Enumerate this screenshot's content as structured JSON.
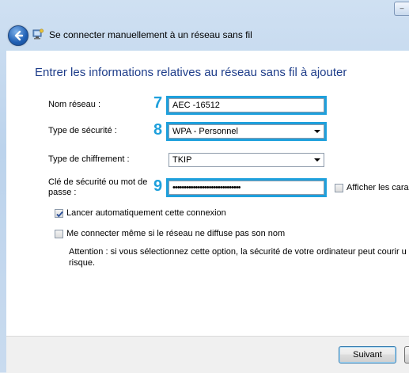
{
  "window": {
    "title": "Se connecter manuellement à un réseau sans fil",
    "minimize_glyph": "–"
  },
  "heading": "Entrer les informations relatives au réseau sans fil à ajouter",
  "form": {
    "network_name": {
      "label": "Nom réseau :",
      "value": "AEC -16512",
      "step": "7"
    },
    "security_type": {
      "label": "Type de sécurité :",
      "value": "WPA - Personnel",
      "step": "8"
    },
    "encryption_type": {
      "label": "Type de chiffrement :",
      "value": "TKIP"
    },
    "security_key": {
      "label_line1": "Clé de sécurité ou mot de",
      "label_line2": "passe :",
      "value": "••••••••••••••••••••••••••••••",
      "step": "9",
      "show_chars_label": "Afficher les cara"
    }
  },
  "options": {
    "auto_connect": {
      "label": "Lancer automatiquement cette connexion",
      "checked": true
    },
    "hidden_network": {
      "label": "Me connecter même si le réseau ne diffuse pas son nom",
      "checked": false
    },
    "warning_line1": "Attention : si vous sélectionnez cette option, la sécurité de votre ordinateur peut courir u",
    "warning_line2": "risque."
  },
  "buttons": {
    "next": "Suivant"
  },
  "colors": {
    "accent": "#1ea0dc",
    "heading": "#1e3d8a"
  }
}
